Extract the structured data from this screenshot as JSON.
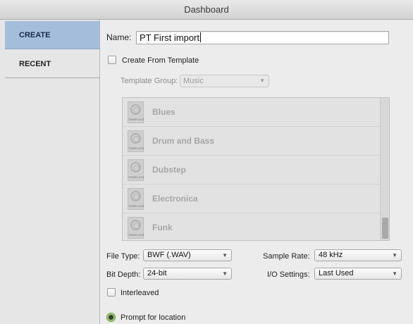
{
  "window": {
    "title": "Dashboard"
  },
  "sidebar": {
    "items": [
      {
        "label": "CREATE",
        "active": true
      },
      {
        "label": "RECENT",
        "active": false
      }
    ]
  },
  "name_field": {
    "label": "Name:",
    "value": "PT First import"
  },
  "create_from_template": {
    "label": "Create From Template",
    "checked": false
  },
  "template_group": {
    "label": "Template Group:",
    "value": "Music",
    "enabled": false
  },
  "templates": [
    {
      "label": "Blues",
      "icon": "template-icon",
      "icon_text": "TEMPLATE"
    },
    {
      "label": "Drum and Bass",
      "icon": "template-icon",
      "icon_text": "TEMPLATE"
    },
    {
      "label": "Dubstep",
      "icon": "template-icon",
      "icon_text": "TEMPLATE"
    },
    {
      "label": "Electronica",
      "icon": "template-icon",
      "icon_text": "TEMPLATE"
    },
    {
      "label": "Funk",
      "icon": "template-icon",
      "icon_text": "TEMPLATE"
    }
  ],
  "settings": {
    "file_type": {
      "label": "File Type:",
      "value": "BWF (.WAV)"
    },
    "sample_rate": {
      "label": "Sample Rate:",
      "value": "48 kHz"
    },
    "bit_depth": {
      "label": "Bit Depth:",
      "value": "24-bit"
    },
    "io_settings": {
      "label": "I/O Settings:",
      "value": "Last Used"
    }
  },
  "interleaved": {
    "label": "Interleaved",
    "checked": false
  },
  "prompt_for_location": {
    "label": "Prompt for location",
    "selected": true
  },
  "colors": {
    "sidebar_active": "#a4bddb",
    "radio_selected": "#9bd26a",
    "window_bg": "#ececec"
  }
}
